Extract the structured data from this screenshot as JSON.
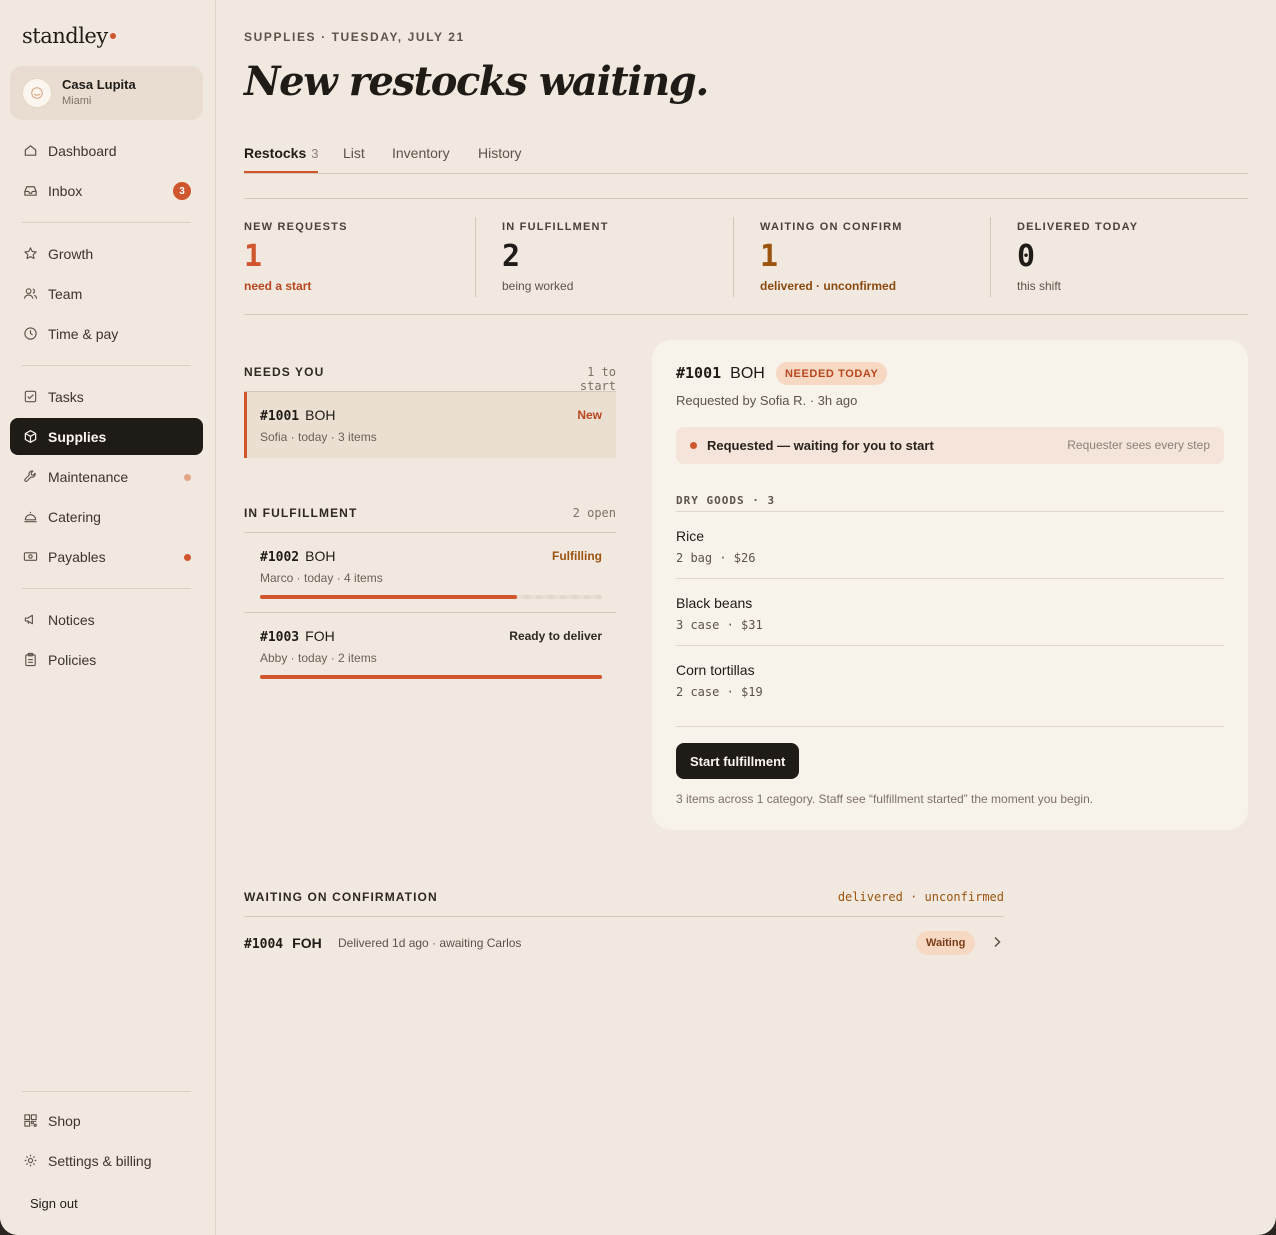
{
  "brand": {
    "name": "standley"
  },
  "org": {
    "name": "Casa Lupita",
    "city": "Miami",
    "avatar_icon": "logo-mark-icon"
  },
  "sidebar": {
    "items": [
      {
        "label": "Dashboard",
        "icon": "home-icon"
      },
      {
        "label": "Inbox",
        "icon": "inbox-icon",
        "badge": "3"
      },
      {
        "label": "Growth",
        "icon": "star-icon"
      },
      {
        "label": "Team",
        "icon": "users-icon"
      },
      {
        "label": "Time & pay",
        "icon": "clock-icon"
      },
      {
        "label": "Tasks",
        "icon": "checkbox-icon"
      },
      {
        "label": "Supplies",
        "icon": "box-icon",
        "active": true
      },
      {
        "label": "Maintenance",
        "icon": "wrench-icon",
        "dot": "soft"
      },
      {
        "label": "Catering",
        "icon": "cloche-icon"
      },
      {
        "label": "Payables",
        "icon": "bill-icon",
        "dot": "strong"
      },
      {
        "label": "Notices",
        "icon": "megaphone-icon"
      },
      {
        "label": "Policies",
        "icon": "clipboard-icon"
      }
    ],
    "footer": [
      {
        "label": "Shop",
        "icon": "qr-icon"
      },
      {
        "label": "Settings & billing",
        "icon": "gear-icon"
      }
    ],
    "sign_out": "Sign out"
  },
  "header": {
    "eyebrow": "SUPPLIES · TUESDAY, JULY 21",
    "title": "New restocks waiting."
  },
  "tabs": [
    {
      "label": "Restocks",
      "count": "3",
      "active": true
    },
    {
      "label": "List"
    },
    {
      "label": "Inventory"
    },
    {
      "label": "History"
    }
  ],
  "stats": [
    {
      "label": "NEW REQUESTS",
      "value": "1",
      "sub": "need a start"
    },
    {
      "label": "IN FULFILLMENT",
      "value": "2",
      "sub": "being worked"
    },
    {
      "label": "WAITING ON CONFIRM",
      "value": "1",
      "sub": "delivered · unconfirmed"
    },
    {
      "label": "DELIVERED TODAY",
      "value": "0",
      "sub": "this shift"
    }
  ],
  "needs_you": {
    "title": "NEEDS YOU",
    "right": "1 to start",
    "requests": [
      {
        "id": "#1001",
        "dept": "BOH",
        "meta": "Sofia · today · 3 items",
        "status": "New"
      }
    ]
  },
  "in_fulfillment": {
    "title": "IN FULFILLMENT",
    "right": "2 open",
    "requests": [
      {
        "id": "#1002",
        "dept": "BOH",
        "meta": "Marco · today · 4 items",
        "status": "Fulfilling",
        "progress": 0.75
      },
      {
        "id": "#1003",
        "dept": "FOH",
        "meta": "Abby · today · 2 items",
        "status": "Ready to deliver",
        "progress": 1.0
      }
    ]
  },
  "detail": {
    "id": "#1001",
    "dept": "BOH",
    "badge": "NEEDED TODAY",
    "requested_by": "Requested by Sofia R. · 3h ago",
    "banner": "Requested — waiting for you to start",
    "banner_aside": "Requester sees every step",
    "category": "DRY GOODS · 3",
    "items": [
      {
        "name": "Rice",
        "meta": "2 bag · $26"
      },
      {
        "name": "Black beans",
        "meta": "3 case · $31"
      },
      {
        "name": "Corn tortillas",
        "meta": "2 case · $19"
      }
    ],
    "button": "Start fulfillment",
    "note": "3 items across 1 category. Staff see “fulfillment started” the moment you begin."
  },
  "waiting": {
    "title": "WAITING ON CONFIRMATION",
    "right": "delivered · unconfirmed",
    "rows": [
      {
        "id": "#1004",
        "dept": "FOH",
        "meta": "Delivered 1d ago · awaiting Carlos",
        "status": "Waiting"
      }
    ]
  },
  "colors": {
    "accent": "#d0562d",
    "ink": "#1f1b17",
    "background": "#f1e9df",
    "amber": "#9a5410"
  }
}
